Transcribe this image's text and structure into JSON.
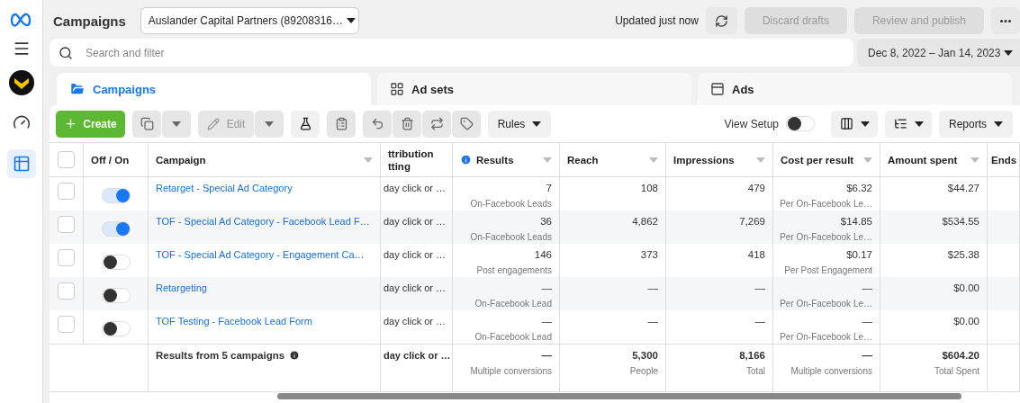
{
  "sidebar": {
    "items": [
      {
        "kind": "gauge",
        "selected": false
      },
      {
        "kind": "table",
        "selected": true
      }
    ]
  },
  "header": {
    "title": "Campaigns",
    "account": "Auslander Capital Partners (89208316…",
    "status": "Updated just now",
    "buttons": [
      {
        "label": "Discard drafts",
        "disabled": true
      },
      {
        "label": "Review and publish",
        "disabled": true
      }
    ]
  },
  "search": {
    "placeholder": "Search and filter"
  },
  "date_range": "Dec 8, 2022 – Jan 14, 2023",
  "tabs": [
    {
      "label": "Campaigns",
      "kind": "campaigns",
      "selected": true
    },
    {
      "label": "Ad sets",
      "kind": "adsets",
      "selected": false
    },
    {
      "label": "Ads",
      "kind": "ads",
      "selected": false
    }
  ],
  "toolbar": {
    "create": "Create",
    "edit": {
      "label": "Edit",
      "disabled": true
    },
    "rules": "Rules",
    "view_setup": {
      "label": "View Setup",
      "on": false
    },
    "reports": "Reports"
  },
  "table": {
    "select_all": false,
    "columns": [
      {
        "label": "Off / On",
        "sortable": false,
        "info": false
      },
      {
        "label": "Campaign",
        "sortable": true,
        "info": false
      },
      {
        "label": "ttribution tting",
        "sortable": false,
        "info": false
      },
      {
        "label": "Results",
        "sortable": true,
        "info": true
      },
      {
        "label": "Reach",
        "sortable": true,
        "info": false
      },
      {
        "label": "Impressions",
        "sortable": true,
        "info": false
      },
      {
        "label": "Cost per result",
        "sortable": true,
        "info": false
      },
      {
        "label": "Amount spent",
        "sortable": true,
        "info": false
      },
      {
        "label": "Ends",
        "info": false
      }
    ],
    "rows": [
      {
        "selected": false,
        "on": true,
        "campaign": "Retarget - Special Ad Category",
        "attribution": "day click or …",
        "results": "7",
        "results_sub": "On-Facebook Leads",
        "reach": "108",
        "impressions": "479",
        "cost": "$6.32",
        "cost_sub": "Per On-Facebook Le…",
        "amount": "$44.27"
      },
      {
        "selected": false,
        "on": true,
        "campaign": "TOF - Special Ad Category - Facebook Lead F…",
        "attribution": "day click or …",
        "results": "36",
        "results_sub": "On-Facebook Leads",
        "reach": "4,862",
        "impressions": "7,269",
        "cost": "$14.85",
        "cost_sub": "Per On-Facebook Le…",
        "amount": "$534.55"
      },
      {
        "selected": false,
        "on": false,
        "campaign": "TOF - Special Ad Category - Engagement Ca…",
        "attribution": "day click or …",
        "results": "146",
        "results_sub": "Post engagements",
        "reach": "373",
        "impressions": "418",
        "cost": "$0.17",
        "cost_sub": "Per Post Engagement",
        "amount": "$25.38"
      },
      {
        "selected": false,
        "on": false,
        "campaign": "Retargeting",
        "attribution": "day click or …",
        "results": "—",
        "results_sub": "On-Facebook Lead",
        "reach": "—",
        "impressions": "—",
        "cost": "—",
        "cost_sub": "Per On-Facebook Le…",
        "amount": "$0.00"
      },
      {
        "selected": false,
        "on": false,
        "campaign": "TOF Testing - Facebook Lead Form",
        "attribution": "day click or …",
        "results": "—",
        "results_sub": "On-Facebook Lead",
        "reach": "—",
        "impressions": "—",
        "cost": "—",
        "cost_sub": "Per On-Facebook Le…",
        "amount": "$0.00"
      }
    ],
    "summary": {
      "label": "Results from 5 campaigns",
      "attribution": "day click or …",
      "results": "—",
      "results_sub": "Multiple conversions",
      "reach": "5,300",
      "reach_sub": "People",
      "impressions": "8,166",
      "impressions_sub": "Total",
      "cost": "—",
      "cost_sub": "Multiple conversions",
      "amount": "$604.20",
      "amount_sub": "Total Spent"
    }
  }
}
